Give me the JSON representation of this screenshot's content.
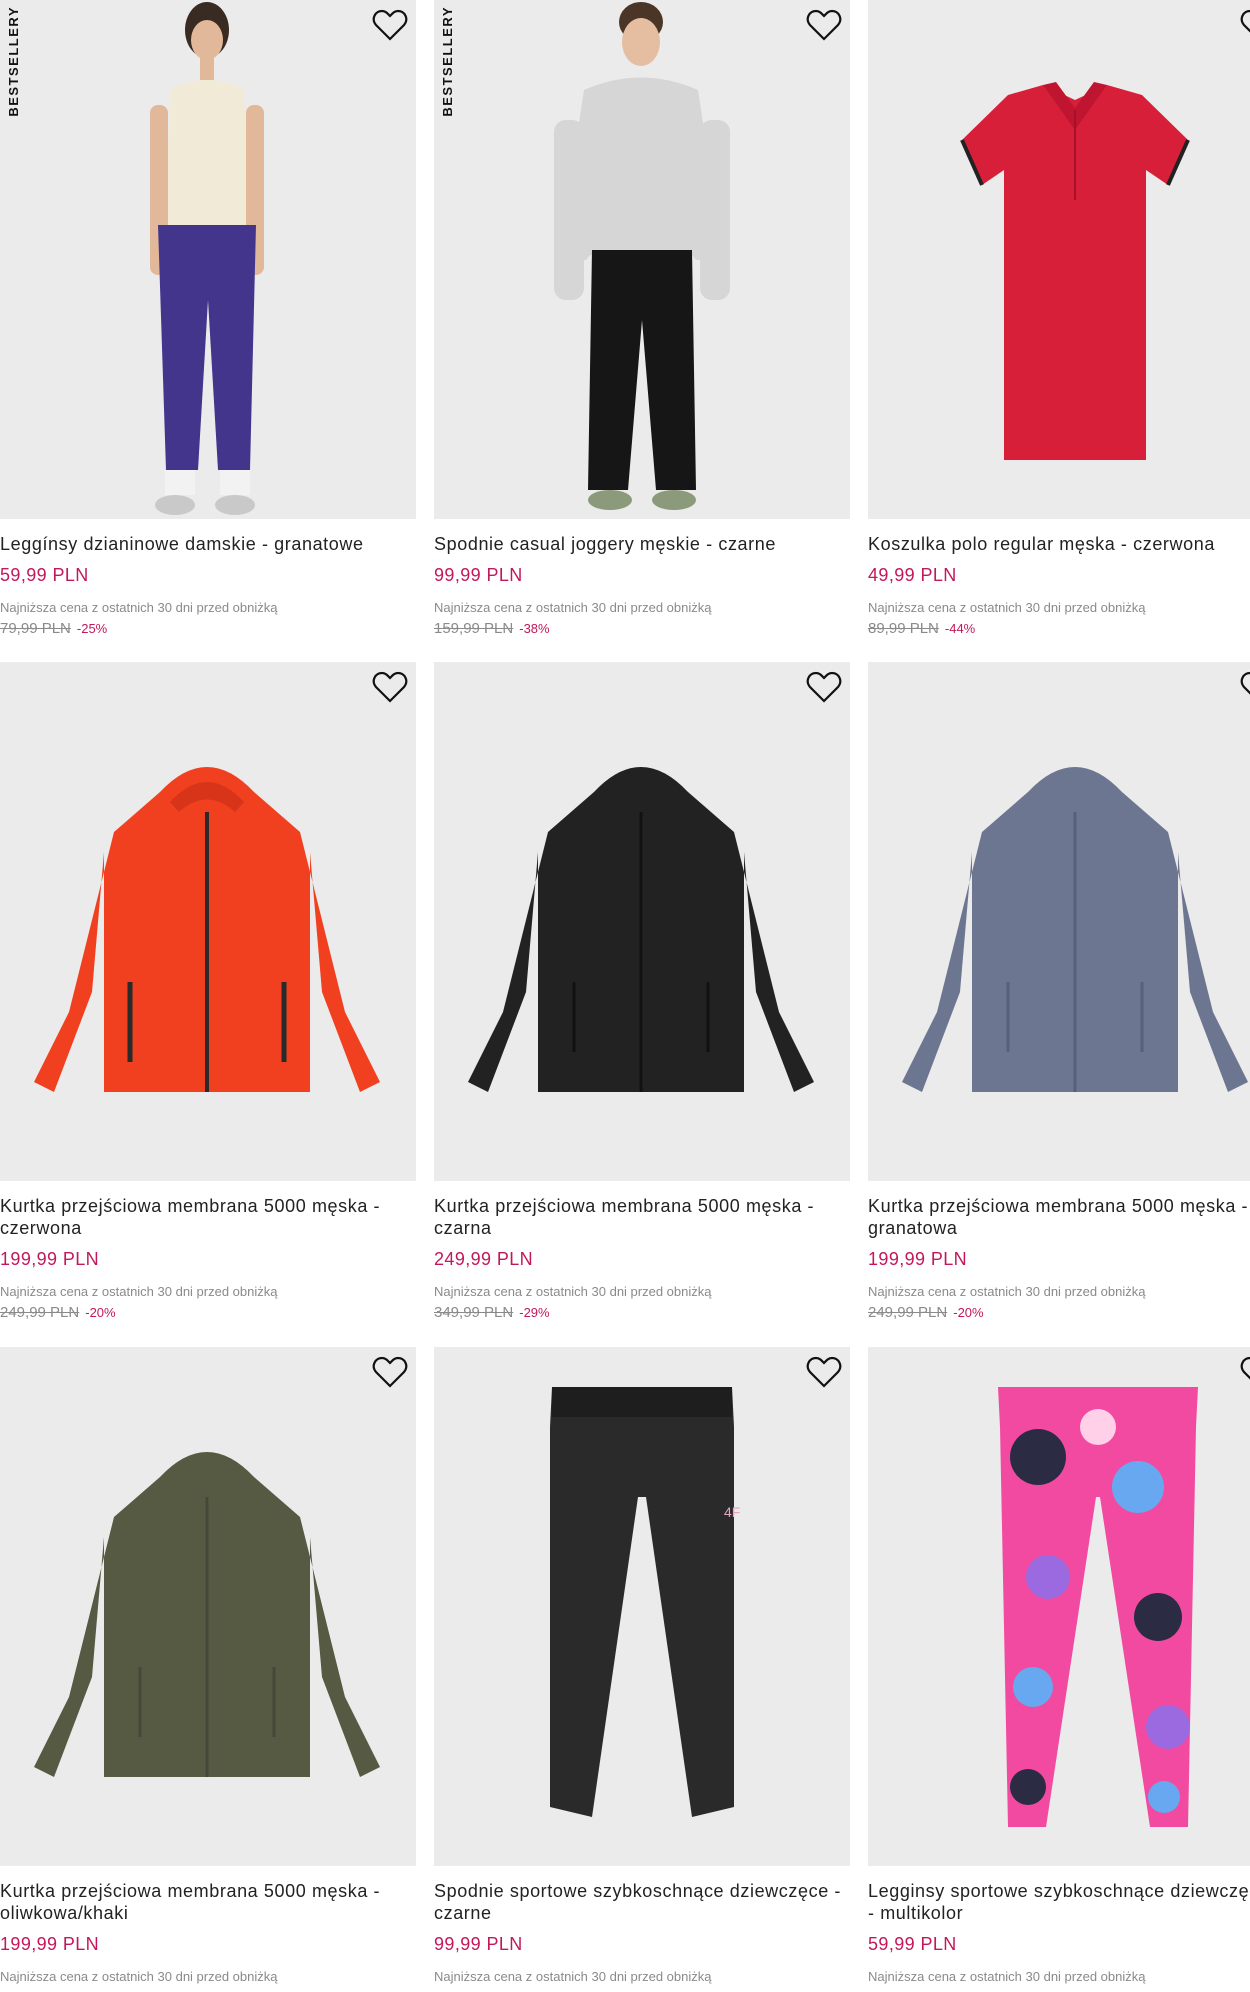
{
  "heart_icon": "heart-outline-icon",
  "lowest_price_note": "Najniższa cena z ostatnich 30 dni przed obniżką",
  "colors": {
    "price": "#c2185b",
    "image_bg": "#ebebeb"
  },
  "products": [
    {
      "badge": "BESTSELLERY",
      "name": "Leggínsy dzianinowe damskie - granatowe",
      "price": "59,99 PLN",
      "old_price": "79,99 PLN",
      "discount": "-25%",
      "image": "woman-leggings-photo"
    },
    {
      "badge": "BESTSELLERY",
      "name": "Spodnie casual joggery męskie - czarne",
      "price": "99,99 PLN",
      "old_price": "159,99 PLN",
      "discount": "-38%",
      "image": "man-joggers-photo"
    },
    {
      "badge": "",
      "name": "Koszulka polo regular męska - czerwona",
      "price": "49,99 PLN",
      "old_price": "89,99 PLN",
      "discount": "-44%",
      "image": "red-polo-shirt"
    },
    {
      "badge": "",
      "name": "Kurtka przejściowa membrana 5000 męska - czerwona",
      "price": "199,99 PLN",
      "old_price": "249,99 PLN",
      "discount": "-20%",
      "image": "red-jacket"
    },
    {
      "badge": "",
      "name": "Kurtka przejściowa membrana 5000 męska - czarna",
      "price": "249,99 PLN",
      "old_price": "349,99 PLN",
      "discount": "-29%",
      "image": "black-jacket"
    },
    {
      "badge": "",
      "name": "Kurtka przejściowa membrana 5000 męska - granatowa",
      "price": "199,99 PLN",
      "old_price": "249,99 PLN",
      "discount": "-20%",
      "image": "grey-blue-jacket"
    },
    {
      "badge": "",
      "name": "Kurtka przejściowa membrana 5000 męska - oliwkowa/khaki",
      "price": "199,99 PLN",
      "old_price": "",
      "discount": "",
      "image": "khaki-jacket"
    },
    {
      "badge": "",
      "name": "Spodnie sportowe szybkoschnące dziewczęce - czarne",
      "price": "99,99 PLN",
      "old_price": "",
      "discount": "",
      "image": "black-sweatpants"
    },
    {
      "badge": "",
      "name": "Legginsy sportowe szybkoschnące dziewczęce - multikolor",
      "price": "59,99 PLN",
      "old_price": "",
      "discount": "",
      "image": "pink-pattern-leggings"
    }
  ]
}
